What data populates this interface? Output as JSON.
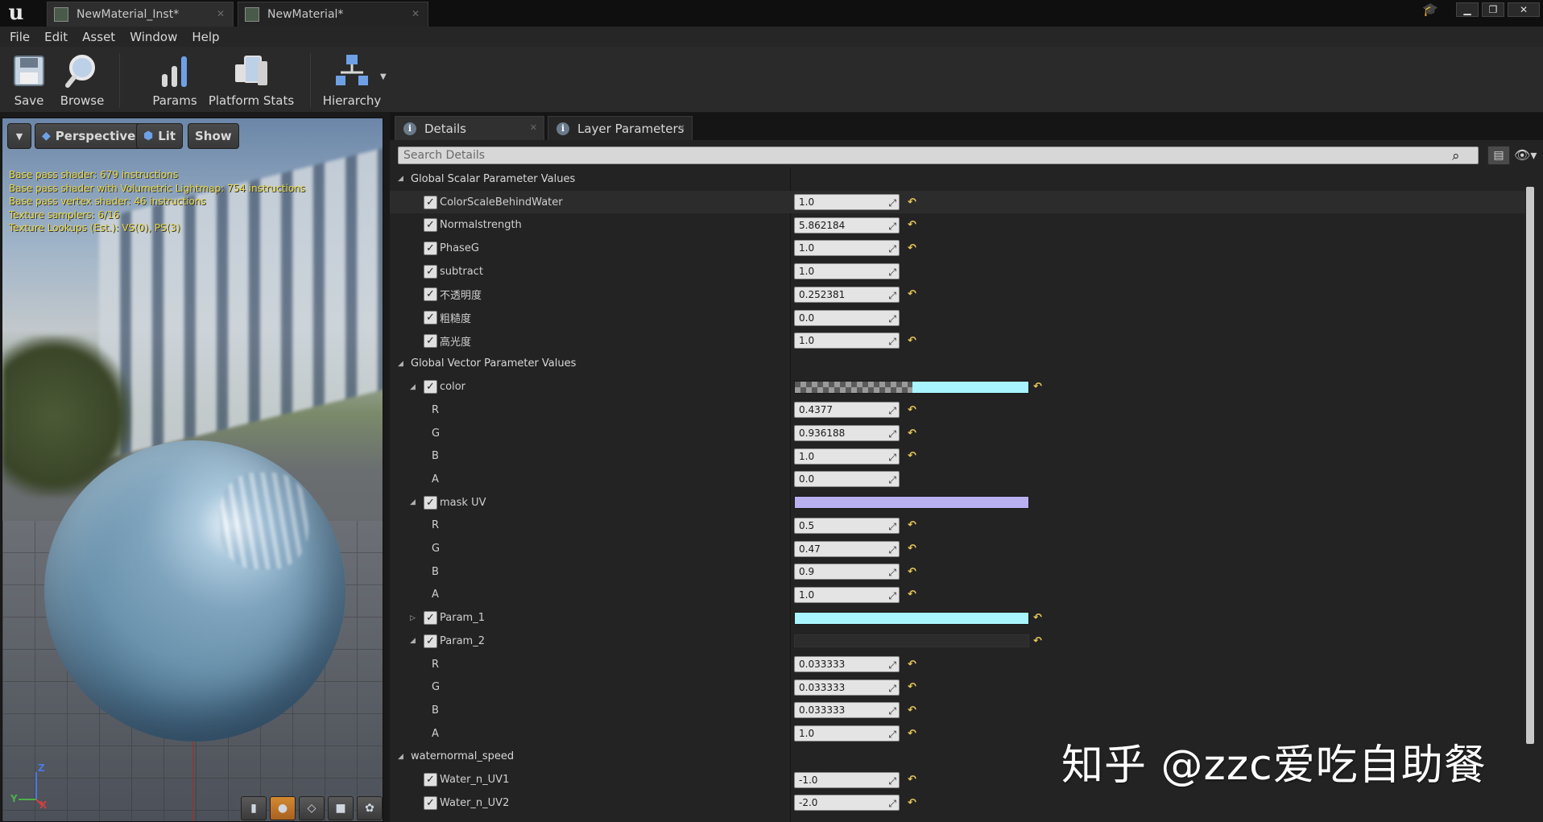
{
  "titlebar": {
    "tabs": [
      {
        "label": "NewMaterial_Inst*"
      },
      {
        "label": "NewMaterial*"
      }
    ]
  },
  "menu": [
    "File",
    "Edit",
    "Asset",
    "Window",
    "Help"
  ],
  "toolbar": {
    "save_label": "Save",
    "browse_label": "Browse",
    "params_label": "Params",
    "platform_stats_label": "Platform Stats",
    "hierarchy_label": "Hierarchy"
  },
  "viewport": {
    "perspective_label": "Perspective",
    "lit_label": "Lit",
    "show_label": "Show",
    "stats": [
      "Base pass shader: 679 instructions",
      "Base pass shader with Volumetric Lightmap: 754 instructions",
      "Base pass vertex shader: 46 instructions",
      "Texture samplers: 6/16",
      "Texture Lookups (Est.): VS(0), PS(3)"
    ],
    "axis_z": "Z",
    "axis_y": "Y",
    "axis_x": "X"
  },
  "panel": {
    "tab_details": "Details",
    "tab_layer_params": "Layer Parameters",
    "search_placeholder": "Search Details"
  },
  "categories": {
    "scalar": "Global Scalar Parameter Values",
    "vector": "Global Vector Parameter Values",
    "waternormal": "waternormal_speed"
  },
  "scalar_params": [
    {
      "name": "ColorScaleBehindWater",
      "value": "1.0"
    },
    {
      "name": "Normalstrength",
      "value": "5.862184"
    },
    {
      "name": "PhaseG",
      "value": "1.0"
    },
    {
      "name": "subtract",
      "value": "1.0"
    },
    {
      "name": "不透明度",
      "value": "0.252381"
    },
    {
      "name": "粗糙度",
      "value": "0.0"
    },
    {
      "name": "高光度",
      "value": "1.0"
    }
  ],
  "vector_params": {
    "color": {
      "name": "color",
      "r": "0.4377",
      "g": "0.936188",
      "b": "1.0",
      "a": "0.0",
      "swatch": "#a8f4ff"
    },
    "mask_uv": {
      "name": "mask UV",
      "r": "0.5",
      "g": "0.47",
      "b": "0.9",
      "a": "1.0",
      "swatch": "#b8b0f0"
    },
    "param_1": {
      "name": "Param_1",
      "swatch": "#a8f4ff"
    },
    "param_2": {
      "name": "Param_2",
      "r": "0.033333",
      "g": "0.033333",
      "b": "0.033333",
      "a": "1.0",
      "swatch": "#2c2c2c"
    }
  },
  "component_labels": {
    "r": "R",
    "g": "G",
    "b": "B",
    "a": "A"
  },
  "waternormal_params": [
    {
      "name": "Water_n_UV1",
      "value": "-1.0"
    },
    {
      "name": "Water_n_UV2",
      "value": "-2.0"
    }
  ],
  "watermark": "知乎 @zzc爱吃自助餐",
  "colors": {
    "accent_reset": "#e8c85a",
    "stats_text": "#e8d84a"
  }
}
